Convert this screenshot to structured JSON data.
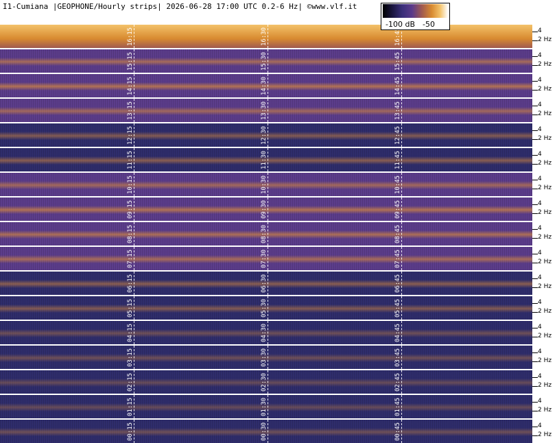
{
  "title": "I1-Cumiana |GEOPHONE/Hourly strips| 2026-06-28 17:00 UTC 0.2-6 Hz| ©www.vlf.it",
  "scale": {
    "label_low": "-100 dB",
    "label_high": "-50",
    "colors": [
      "#000000",
      "#2c2a6a",
      "#5a3a8a",
      "#a05a50",
      "#d88a30",
      "#f3c26a",
      "#ffffff"
    ]
  },
  "chart_data": {
    "type": "heatmap",
    "title": "I1-Cumiana |GEOPHONE/Hourly strips| 2026-06-28 17:00 UTC 0.2-6 Hz| ©www.vlf.it",
    "xlabel": "",
    "ylabel": "",
    "frequency_range_hz": [
      0.2,
      6
    ],
    "y_tick_labels": [
      "4",
      "2 Hz"
    ],
    "colorbar": {
      "min_db": -100,
      "max_db": -50,
      "tick_labels": [
        "-100 dB",
        "-50"
      ]
    },
    "strips": [
      {
        "hour": "16",
        "time_labels": [
          "16:15",
          "16:30",
          "16:45"
        ]
      },
      {
        "hour": "15",
        "time_labels": [
          "15:15",
          "15:30",
          "15:45"
        ]
      },
      {
        "hour": "14",
        "time_labels": [
          "14:15",
          "14:30",
          "14:45"
        ]
      },
      {
        "hour": "13",
        "time_labels": [
          "13:15",
          "13:30",
          "13:45"
        ]
      },
      {
        "hour": "12",
        "time_labels": [
          "12:15",
          "12:30",
          "12:45"
        ]
      },
      {
        "hour": "11",
        "time_labels": [
          "11:15",
          "11:30",
          "11:45"
        ]
      },
      {
        "hour": "10",
        "time_labels": [
          "10:15",
          "10:30",
          "10:45"
        ]
      },
      {
        "hour": "09",
        "time_labels": [
          "09:15",
          "09:30",
          "09:45"
        ]
      },
      {
        "hour": "08",
        "time_labels": [
          "08:15",
          "08:30",
          "08:45"
        ]
      },
      {
        "hour": "07",
        "time_labels": [
          "07:15",
          "07:30",
          "07:45"
        ]
      },
      {
        "hour": "06",
        "time_labels": [
          "06:15",
          "06:30",
          "06:45"
        ]
      },
      {
        "hour": "05",
        "time_labels": [
          "05:15",
          "05:30",
          "05:45"
        ]
      },
      {
        "hour": "04",
        "time_labels": [
          "04:15",
          "04:30",
          "04:45"
        ]
      },
      {
        "hour": "03",
        "time_labels": [
          "03:15",
          "03:30",
          "03:45"
        ]
      },
      {
        "hour": "02",
        "time_labels": [
          "02:15",
          "02:30",
          "02:45"
        ]
      },
      {
        "hour": "01",
        "time_labels": [
          "01:15",
          "01:30",
          "01:45"
        ]
      },
      {
        "hour": "00",
        "time_labels": [
          "00:15",
          "00:30",
          "00:45"
        ]
      }
    ],
    "strip_intensity": [
      0.95,
      0.6,
      0.7,
      0.55,
      0.45,
      0.5,
      0.55,
      0.7,
      0.65,
      0.6,
      0.5,
      0.45,
      0.3,
      0.3,
      0.25,
      0.25,
      0.3
    ]
  }
}
